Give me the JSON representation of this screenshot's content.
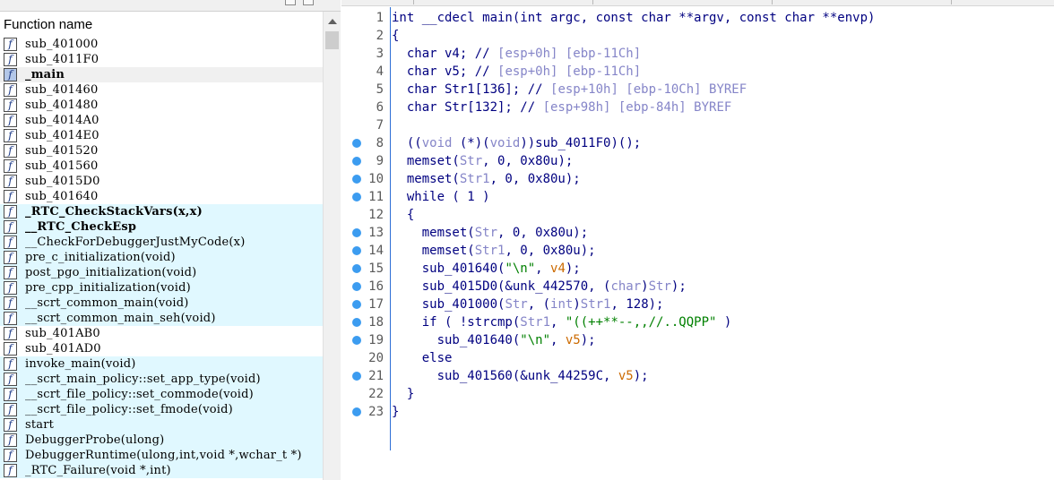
{
  "functions_pane": {
    "header": "Function name",
    "items": [
      {
        "name": "sub_401000",
        "type": "normal"
      },
      {
        "name": "sub_4011F0",
        "type": "normal"
      },
      {
        "name": "_main",
        "type": "selected"
      },
      {
        "name": "sub_401460",
        "type": "normal"
      },
      {
        "name": "sub_401480",
        "type": "normal"
      },
      {
        "name": "sub_4014A0",
        "type": "normal"
      },
      {
        "name": "sub_4014E0",
        "type": "normal"
      },
      {
        "name": "sub_401520",
        "type": "normal"
      },
      {
        "name": "sub_401560",
        "type": "normal"
      },
      {
        "name": "sub_4015D0",
        "type": "normal"
      },
      {
        "name": "sub_401640",
        "type": "normal"
      },
      {
        "name": "_RTC_CheckStackVars(x,x)",
        "type": "lib-bold"
      },
      {
        "name": "__RTC_CheckEsp",
        "type": "lib-bold"
      },
      {
        "name": "__CheckForDebuggerJustMyCode(x)",
        "type": "lib"
      },
      {
        "name": "pre_c_initialization(void)",
        "type": "lib"
      },
      {
        "name": "post_pgo_initialization(void)",
        "type": "lib"
      },
      {
        "name": "pre_cpp_initialization(void)",
        "type": "lib"
      },
      {
        "name": "__scrt_common_main(void)",
        "type": "lib"
      },
      {
        "name": "__scrt_common_main_seh(void)",
        "type": "lib"
      },
      {
        "name": "sub_401AB0",
        "type": "normal"
      },
      {
        "name": "sub_401AD0",
        "type": "normal"
      },
      {
        "name": "invoke_main(void)",
        "type": "lib"
      },
      {
        "name": "__scrt_main_policy::set_app_type(void)",
        "type": "lib"
      },
      {
        "name": "__scrt_file_policy::set_commode(void)",
        "type": "lib"
      },
      {
        "name": "__scrt_file_policy::set_fmode(void)",
        "type": "lib"
      },
      {
        "name": "start",
        "type": "lib"
      },
      {
        "name": "DebuggerProbe(ulong)",
        "type": "lib"
      },
      {
        "name": "DebuggerRuntime(ulong,int,void *,wchar_t *)",
        "type": "lib"
      },
      {
        "name": "_RTC_Failure(void *,int)",
        "type": "lib"
      }
    ],
    "icon_glyph": "f",
    "icon_name": "function-icon"
  },
  "pseudocode": {
    "lines": [
      {
        "n": "1",
        "dot": false,
        "segs": [
          [
            "k",
            "int __cdecl main(int argc, const char **argv, const char **envp)"
          ]
        ]
      },
      {
        "n": "2",
        "dot": false,
        "segs": [
          [
            "k",
            "{"
          ]
        ]
      },
      {
        "n": "3",
        "dot": false,
        "segs": [
          [
            "k",
            "  char v4; // "
          ],
          [
            "c",
            "[esp+0h] [ebp-11Ch]"
          ]
        ]
      },
      {
        "n": "4",
        "dot": false,
        "segs": [
          [
            "k",
            "  char v5; // "
          ],
          [
            "c",
            "[esp+0h] [ebp-11Ch]"
          ]
        ]
      },
      {
        "n": "5",
        "dot": false,
        "segs": [
          [
            "k",
            "  char Str1[136]; // "
          ],
          [
            "c",
            "[esp+10h] [ebp-10Ch] BYREF"
          ]
        ]
      },
      {
        "n": "6",
        "dot": false,
        "segs": [
          [
            "k",
            "  char Str[132]; // "
          ],
          [
            "c",
            "[esp+98h] [ebp-84h] BYREF"
          ]
        ]
      },
      {
        "n": "7",
        "dot": false,
        "segs": [
          [
            "k",
            ""
          ]
        ]
      },
      {
        "n": "8",
        "dot": true,
        "segs": [
          [
            "k",
            "  (("
          ],
          [
            "c",
            "void"
          ],
          [
            "k",
            " (*)("
          ],
          [
            "c",
            "void"
          ],
          [
            "k",
            "))sub_4011F0)();"
          ]
        ]
      },
      {
        "n": "9",
        "dot": true,
        "segs": [
          [
            "k",
            "  memset("
          ],
          [
            "c",
            "Str"
          ],
          [
            "k",
            ", 0, 0x80u);"
          ]
        ]
      },
      {
        "n": "10",
        "dot": true,
        "segs": [
          [
            "k",
            "  memset("
          ],
          [
            "c",
            "Str1"
          ],
          [
            "k",
            ", 0, 0x80u);"
          ]
        ]
      },
      {
        "n": "11",
        "dot": true,
        "segs": [
          [
            "k",
            "  while ( 1 )"
          ]
        ]
      },
      {
        "n": "12",
        "dot": false,
        "segs": [
          [
            "k",
            "  {"
          ]
        ]
      },
      {
        "n": "13",
        "dot": true,
        "segs": [
          [
            "k",
            "    memset("
          ],
          [
            "c",
            "Str"
          ],
          [
            "k",
            ", 0, 0x80u);"
          ]
        ]
      },
      {
        "n": "14",
        "dot": true,
        "segs": [
          [
            "k",
            "    memset("
          ],
          [
            "c",
            "Str1"
          ],
          [
            "k",
            ", 0, 0x80u);"
          ]
        ]
      },
      {
        "n": "15",
        "dot": true,
        "segs": [
          [
            "k",
            "    sub_401640("
          ],
          [
            "s",
            "\"\\n\""
          ],
          [
            "k",
            ", "
          ],
          [
            "v",
            "v4"
          ],
          [
            "k",
            ");"
          ]
        ]
      },
      {
        "n": "16",
        "dot": true,
        "segs": [
          [
            "k",
            "    sub_4015D0(&unk_442570, ("
          ],
          [
            "c",
            "char"
          ],
          [
            "k",
            ")"
          ],
          [
            "c",
            "Str"
          ],
          [
            "k",
            ");"
          ]
        ]
      },
      {
        "n": "17",
        "dot": true,
        "segs": [
          [
            "k",
            "    sub_401000("
          ],
          [
            "c",
            "Str"
          ],
          [
            "k",
            ", ("
          ],
          [
            "c",
            "int"
          ],
          [
            "k",
            ")"
          ],
          [
            "c",
            "Str1"
          ],
          [
            "k",
            ", 128);"
          ]
        ]
      },
      {
        "n": "18",
        "dot": true,
        "segs": [
          [
            "k",
            "    if ( !strcmp("
          ],
          [
            "c",
            "Str1"
          ],
          [
            "k",
            ", "
          ],
          [
            "s",
            "\"((++**--,,//..QQPP\""
          ],
          [
            "k",
            " )"
          ]
        ]
      },
      {
        "n": "19",
        "dot": true,
        "segs": [
          [
            "k",
            "      sub_401640("
          ],
          [
            "s",
            "\"\\n\""
          ],
          [
            "k",
            ", "
          ],
          [
            "v",
            "v5"
          ],
          [
            "k",
            ");"
          ]
        ]
      },
      {
        "n": "20",
        "dot": false,
        "segs": [
          [
            "k",
            "    else"
          ]
        ]
      },
      {
        "n": "21",
        "dot": true,
        "segs": [
          [
            "k",
            "      sub_401560(&unk_44259C, "
          ],
          [
            "v",
            "v5"
          ],
          [
            "k",
            ");"
          ]
        ]
      },
      {
        "n": "22",
        "dot": false,
        "segs": [
          [
            "k",
            "  }"
          ]
        ]
      },
      {
        "n": "23",
        "dot": true,
        "segs": [
          [
            "k",
            "}"
          ]
        ]
      }
    ]
  },
  "colors": {
    "keyword_text": "#000080",
    "comment": "#8585c8",
    "string": "#008000",
    "variable": "#cc6a00",
    "lib_row": "#e0f8ff",
    "breakpoint_dot": "#3c9cf0",
    "gutter_separator": "#2d6fd6"
  }
}
